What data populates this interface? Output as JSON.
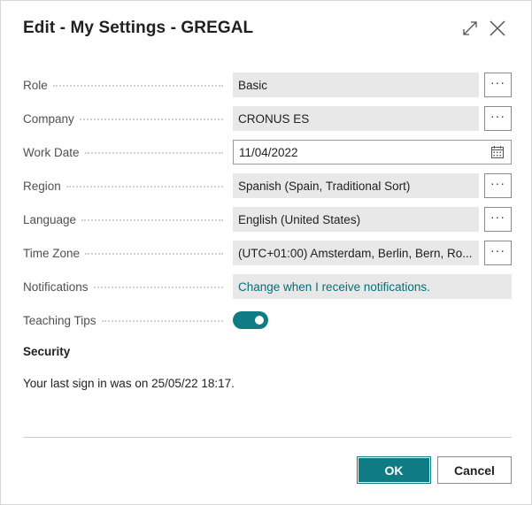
{
  "dialog": {
    "title": "Edit - My Settings - GREGAL",
    "expand_icon": "expand-icon",
    "close_icon": "close-icon"
  },
  "fields": {
    "role": {
      "label": "Role",
      "value": "Basic"
    },
    "company": {
      "label": "Company",
      "value": "CRONUS ES"
    },
    "work_date": {
      "label": "Work Date",
      "value": "11/04/2022"
    },
    "region": {
      "label": "Region",
      "value": "Spanish (Spain, Traditional Sort)"
    },
    "language": {
      "label": "Language",
      "value": "English (United States)"
    },
    "time_zone": {
      "label": "Time Zone",
      "value": "(UTC+01:00) Amsterdam, Berlin, Bern, Ro..."
    },
    "notifications": {
      "label": "Notifications",
      "value": "Change when I receive notifications."
    },
    "teaching_tips": {
      "label": "Teaching Tips",
      "enabled": true
    }
  },
  "lookup_button_label": "···",
  "security": {
    "heading": "Security",
    "last_sign_in": "Your last sign in was on 25/05/22 18:17."
  },
  "buttons": {
    "ok": "OK",
    "cancel": "Cancel"
  },
  "colors": {
    "accent": "#0f7c84",
    "field_bg": "#e8e8e8",
    "link": "#00707a"
  }
}
